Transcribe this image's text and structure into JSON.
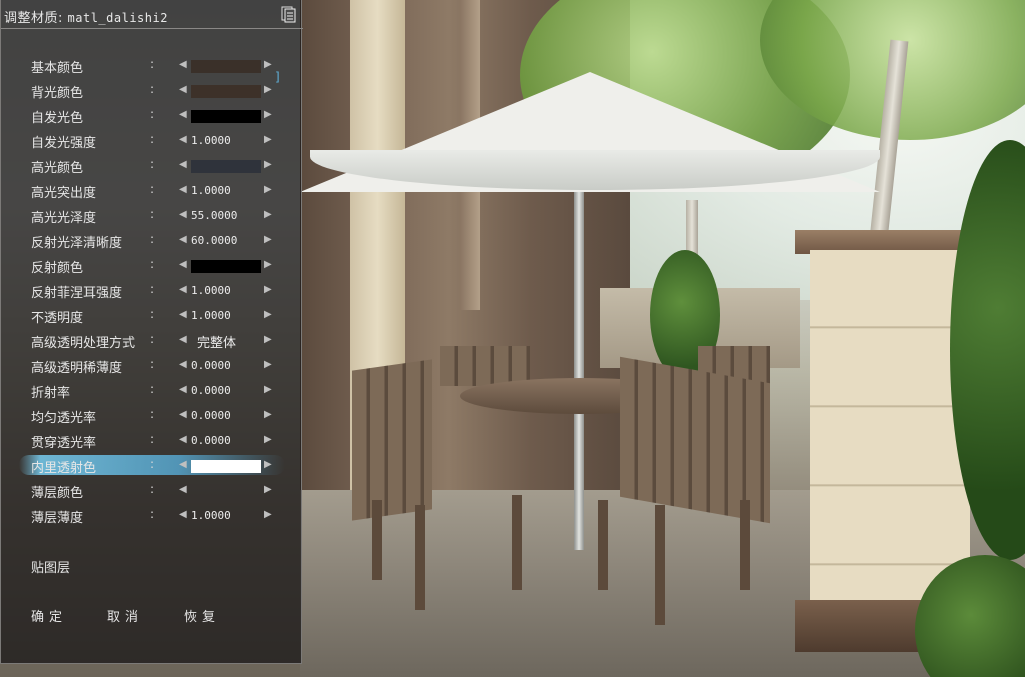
{
  "dialog": {
    "title_prefix": "调整材质:",
    "material_name": "matl_dalishi2"
  },
  "properties": [
    {
      "label": "基本颜色",
      "type": "color",
      "color": "#3a3029"
    },
    {
      "label": "背光颜色",
      "type": "color",
      "color": "#3d3129"
    },
    {
      "label": "自发光色",
      "type": "color",
      "color": "#000000"
    },
    {
      "label": "自发光强度",
      "type": "number",
      "value": "1.0000"
    },
    {
      "label": "高光颜色",
      "type": "color",
      "color": "#2f333b"
    },
    {
      "label": "高光突出度",
      "type": "number",
      "value": "1.0000"
    },
    {
      "label": "高光光泽度",
      "type": "number",
      "value": "55.0000"
    },
    {
      "label": "反射光泽清晰度",
      "type": "number",
      "value": "60.0000"
    },
    {
      "label": "反射颜色",
      "type": "color",
      "color": "#000000"
    },
    {
      "label": "反射菲涅耳强度",
      "type": "number",
      "value": "1.0000"
    },
    {
      "label": "不透明度",
      "type": "number",
      "value": "1.0000"
    },
    {
      "label": "高级透明处理方式",
      "type": "text",
      "value": "完整体"
    },
    {
      "label": "高级透明稀薄度",
      "type": "number",
      "value": "0.0000"
    },
    {
      "label": "折射率",
      "type": "number",
      "value": "0.0000"
    },
    {
      "label": "均匀透光率",
      "type": "number",
      "value": "0.0000"
    },
    {
      "label": "贯穿透光率",
      "type": "number",
      "value": "0.0000"
    },
    {
      "label": "内里透射色",
      "type": "color",
      "color": "#ffffff",
      "selected": true
    },
    {
      "label": "薄层颜色",
      "type": "empty"
    },
    {
      "label": "薄层薄度",
      "type": "number",
      "value": "1.0000"
    }
  ],
  "sections": {
    "texture_layer": "贴图层"
  },
  "buttons": {
    "ok": "确定",
    "cancel": "取消",
    "restore": "恢复"
  },
  "colors": {
    "panel_bg": "#1c1a1a",
    "selection_highlight": "#78cdf0"
  },
  "icons": [
    "document-icon",
    "arrow-left-icon",
    "arrow-right-icon"
  ]
}
